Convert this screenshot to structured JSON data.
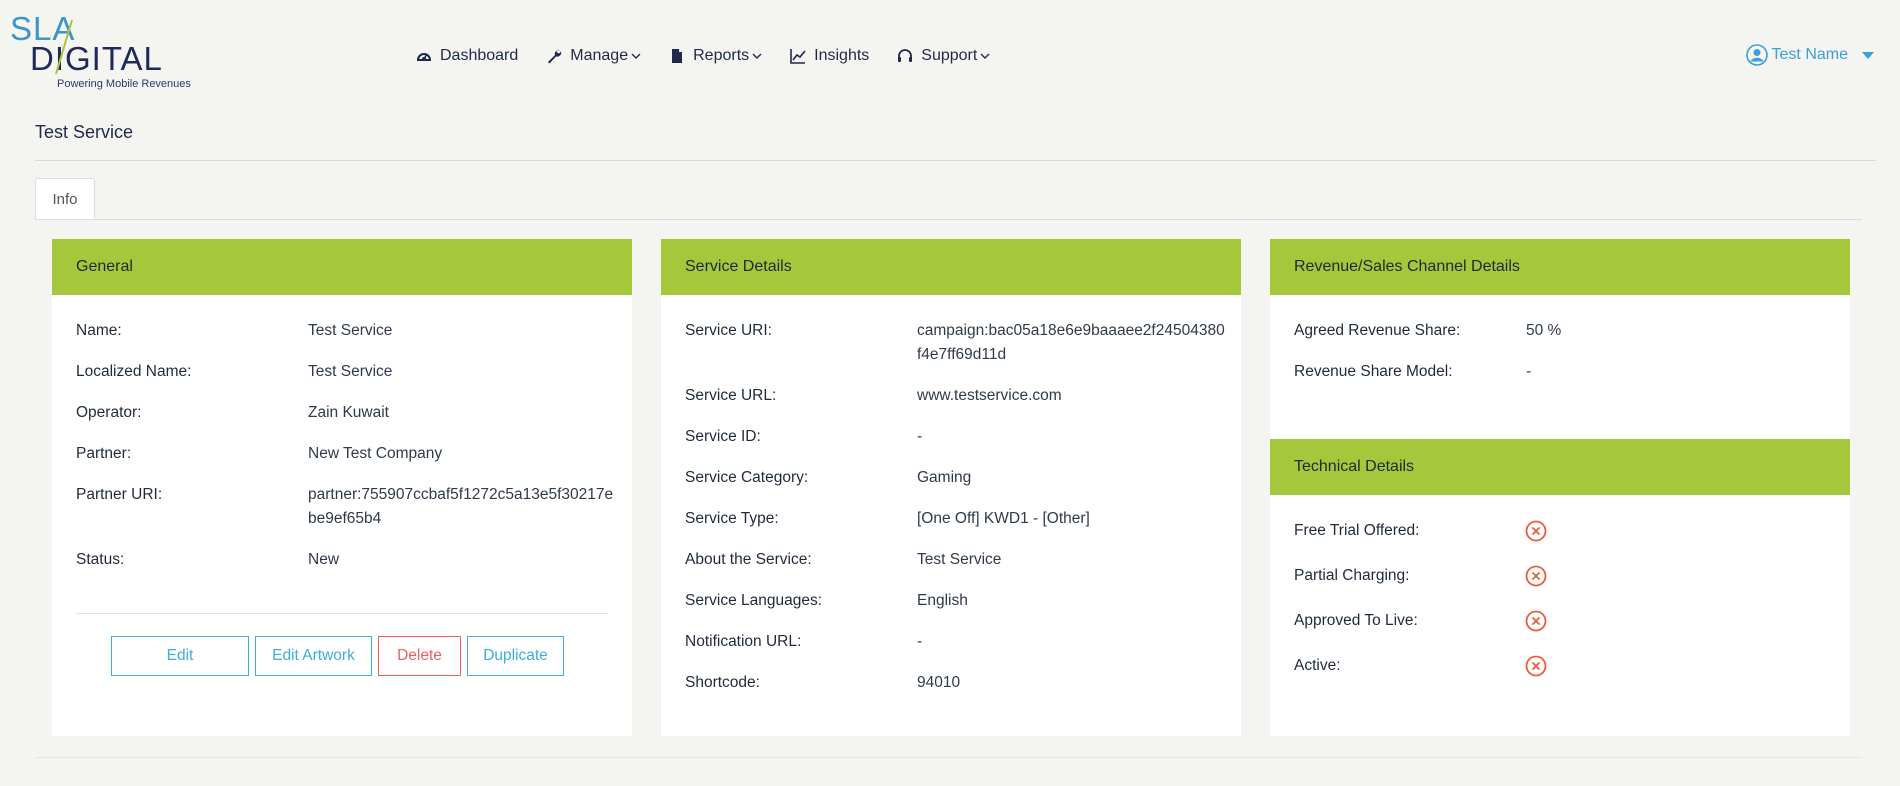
{
  "brand": {
    "top": "SLA",
    "bottom": "DIGITAL",
    "tagline": "Powering Mobile Revenues",
    "colors": {
      "blue": "#3a95c8",
      "navy": "#1f2a5a",
      "green": "#a5c73c"
    }
  },
  "nav": {
    "items": [
      {
        "label": "Dashboard",
        "icon": "dashboard-icon",
        "dropdown": false
      },
      {
        "label": "Manage",
        "icon": "wrench-icon",
        "dropdown": true
      },
      {
        "label": "Reports",
        "icon": "file-icon",
        "dropdown": true
      },
      {
        "label": "Insights",
        "icon": "line-chart-icon",
        "dropdown": false
      },
      {
        "label": "Support",
        "icon": "headset-icon",
        "dropdown": true
      }
    ]
  },
  "user": {
    "name": "Test Name"
  },
  "page": {
    "title": "Test Service"
  },
  "tabs": [
    {
      "label": "Info",
      "active": true
    }
  ],
  "general": {
    "title": "General",
    "rows": [
      {
        "key": "Name:",
        "value": "Test Service"
      },
      {
        "key": "Localized Name:",
        "value": "Test Service"
      },
      {
        "key": "Operator:",
        "value": "Zain Kuwait"
      },
      {
        "key": "Partner:",
        "value": "New Test Company"
      },
      {
        "key": "Partner URI:",
        "value": "partner:755907ccbaf5f1272c5a13e5f30217ebe9ef65b4"
      },
      {
        "key": "Status:",
        "value": "New"
      }
    ],
    "buttons": {
      "edit": "Edit",
      "edit_artwork": "Edit Artwork",
      "delete": "Delete",
      "duplicate": "Duplicate"
    }
  },
  "service_details": {
    "title": "Service Details",
    "rows": [
      {
        "key": "Service URI:",
        "value": "campaign:bac05a18e6e9baaaee2f24504380f4e7ff69d11d"
      },
      {
        "key": "Service URL:",
        "value": "www.testservice.com"
      },
      {
        "key": "Service ID:",
        "value": "-"
      },
      {
        "key": "Service Category:",
        "value": "Gaming"
      },
      {
        "key": "Service Type:",
        "value": "[One Off] KWD1 - [Other]"
      },
      {
        "key": "About the Service:",
        "value": "Test Service"
      },
      {
        "key": "Service Languages:",
        "value": "English"
      },
      {
        "key": "Notification URL:",
        "value": "-"
      },
      {
        "key": "Shortcode:",
        "value": "94010"
      }
    ]
  },
  "revenue": {
    "title": "Revenue/Sales Channel Details",
    "rows": [
      {
        "key": "Agreed Revenue Share:",
        "value": "50 %"
      },
      {
        "key": "Revenue Share Model:",
        "value": "-"
      }
    ]
  },
  "technical": {
    "title": "Technical Details",
    "status_color": "#ef5a3a",
    "rows": [
      {
        "key": "Free Trial Offered:",
        "status": "no"
      },
      {
        "key": "Partial Charging:",
        "status": "no"
      },
      {
        "key": "Approved To Live:",
        "status": "no"
      },
      {
        "key": "Active:",
        "status": "no"
      }
    ]
  }
}
